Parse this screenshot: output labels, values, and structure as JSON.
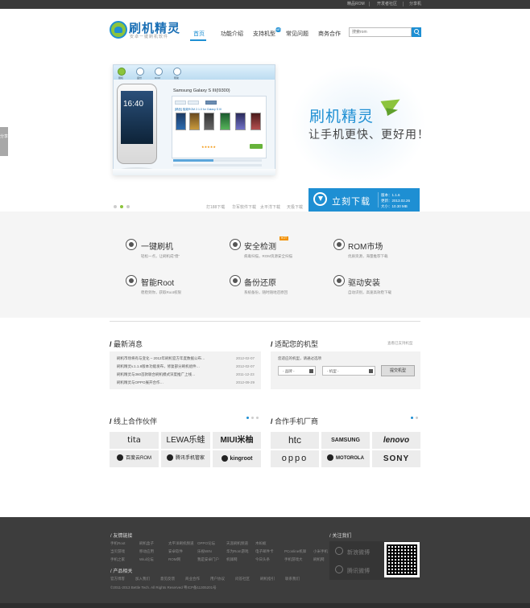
{
  "topbar": {
    "links": [
      "精品ROM",
      "开发者社区",
      "分享机"
    ]
  },
  "header": {
    "logo_title": "刷机精灵",
    "logo_subtitle": "安卓一键刷机软件",
    "nav": [
      "首页",
      "功能介绍",
      "支持机型",
      "常见问题",
      "商务合作"
    ],
    "new_badge": "NEW",
    "search_placeholder": "搜索rom"
  },
  "hero": {
    "app_tabs": [
      "刷机",
      "备份",
      "ROM",
      "帮助"
    ],
    "app_model": "Samsung Galaxy S III(I9300)",
    "app_panel_tabs": [
      "推荐",
      "全部",
      "官方"
    ],
    "app_rom_title": "[精品] 极致ROM 2.1.0 for Galaxy S III",
    "app_rating": "★★★★★",
    "phone_time": "16:40",
    "slogan_title": "刷机精灵",
    "slogan_sub": "让手机更快、更好用！",
    "download_label": "立刻下载",
    "version_info": [
      "版本：1.1.6",
      "更新：2013.02.26",
      "大小：10.30 MB"
    ],
    "store_links": [
      "打188下载",
      "华军软件下载",
      "太平洋下载",
      "天极下载"
    ],
    "side_share": "分享"
  },
  "features": [
    {
      "title": "一键刷机",
      "desc": "轻松一点，让刷机成“傻”"
    },
    {
      "title": "安全检测",
      "desc": "病毒扫描，ROM资源安全扫描"
    },
    {
      "title": "ROM市场",
      "desc": "优质资源，海量推荐下载"
    },
    {
      "title": "智能Root",
      "desc": "稳稳到你，获取Root权限"
    },
    {
      "title": "备份还原",
      "desc": "系统备份，随时随地还原回"
    },
    {
      "title": "驱动安装",
      "desc": "自动识别，高速高效稳下载"
    }
  ],
  "hot_badge": "HOT",
  "news": {
    "title": "最新消息",
    "items": [
      {
        "text": "刷机市场将有与变化 – 2012年刷机官方年度数据公布…",
        "date": "2012-02-07"
      },
      {
        "text": "刷机精灵v.1.1.8版本功能发布，修复部分刷机组件…",
        "date": "2012-02-07"
      },
      {
        "text": "刷机精灵与360首款联合刷机模式深度推广上线…",
        "date": "2011-12-23"
      },
      {
        "text": "刷机精灵与OPPO展开合作…",
        "date": "2012-09-29"
      }
    ]
  },
  "fit": {
    "title": "适配您的机型",
    "more_link": "查看已支持机型",
    "label": "您适应的机型，请通过选项",
    "brand_select": "- 品牌 -",
    "model_select": "- 机型 -",
    "button": "提交机型"
  },
  "partners": {
    "title": "线上合作伙伴",
    "logos": [
      "tita",
      "LEWA乐蛙",
      "MIUI米柚",
      "百度云ROM",
      "腾讯手机管家",
      "kingroot"
    ]
  },
  "makers": {
    "title": "合作手机厂商",
    "logos": [
      "htc",
      "SAMSUNG",
      "lenovo",
      "oppo",
      "MOTOROLA",
      "SONY"
    ]
  },
  "footer": {
    "links_title": "友情链接",
    "links": [
      "手机Root",
      "刷机盒子",
      "太平洋刷机频道",
      "OPPO论坛",
      "天涯刷机频道",
      "木蚂蚁",
      "当贝游戏",
      "移动应用",
      "安卓软件",
      "乐视WIN",
      "华为Rom游戏",
      "电子邮件卡",
      "PConline机锋",
      "小米手机",
      "手机之家",
      "Wiui论坛",
      "ROM网",
      "我是安卓门户",
      "机锋网",
      "今日头条",
      "手机游戏大",
      "刷机网"
    ],
    "product_title": "产品相关",
    "product_links": [
      "官方博客",
      "加入我们",
      "意见反馈",
      "商业合作",
      "用户协议",
      "问答社区",
      "刷机指引",
      "联系我们"
    ],
    "copyright": "©2011-2013 Bettle Tech. All Rights Reserved 粤ICP备11305201号",
    "follow_title": "关注我们",
    "follow_items": [
      "新浪微博",
      "腾讯微博"
    ]
  }
}
